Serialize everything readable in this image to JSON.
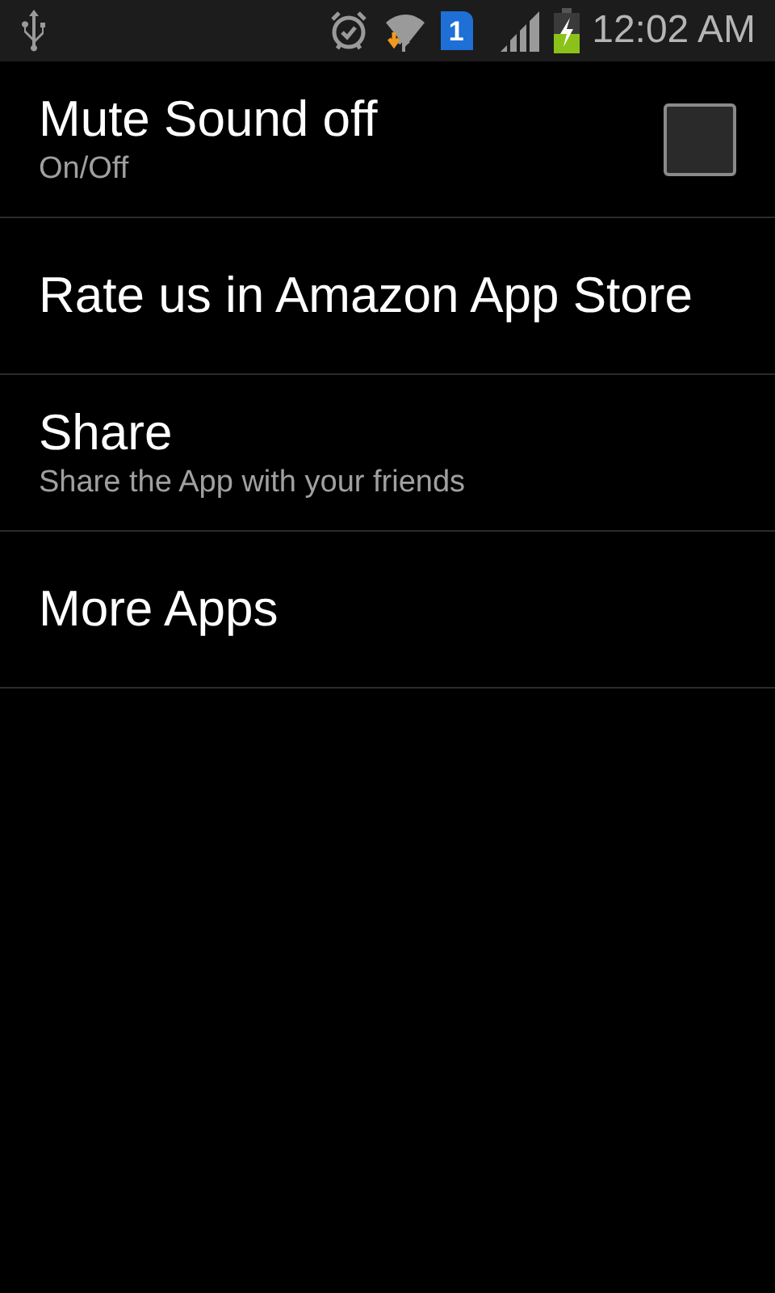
{
  "status_bar": {
    "sim_badge": "1",
    "time": "12:02 AM"
  },
  "settings": [
    {
      "kind": "checkbox",
      "title": "Mute Sound off",
      "summary": "On/Off",
      "checked": false
    },
    {
      "kind": "plain",
      "title": "Rate us in Amazon App Store"
    },
    {
      "kind": "plain",
      "title": "Share",
      "summary": "Share the App with your friends"
    },
    {
      "kind": "plain",
      "title": "More Apps"
    }
  ]
}
